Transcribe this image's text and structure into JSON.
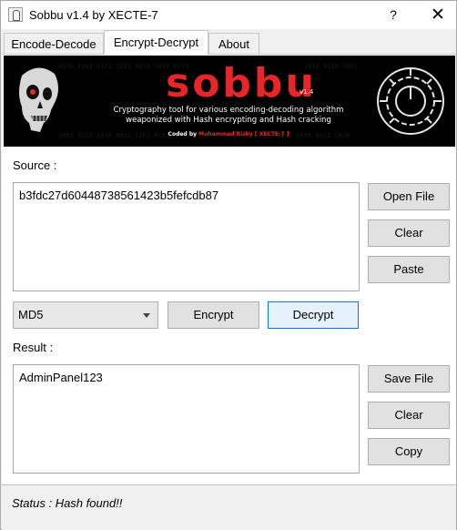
{
  "window": {
    "title": "Sobbu v1.4 by XECTE-7",
    "help": "?",
    "close": "✕"
  },
  "tabs": [
    {
      "label": "Encode-Decode"
    },
    {
      "label": "Encrypt-Decrypt"
    },
    {
      "label": "About"
    }
  ],
  "banner": {
    "logo_text": "sobbu",
    "version": "v1.4",
    "tagline1": "Cryptography tool for various encoding-decoding algorithm",
    "tagline2": "weaponized with Hash encrypting and Hash cracking",
    "coded_by": "Coded by ",
    "author": "Muhammad Rizky [ XECTE-7 ]",
    "colors": {
      "logo": "#e8262a",
      "text": "#ffffff",
      "author": "#e8262a"
    }
  },
  "source": {
    "label": "Source :",
    "value": "b3fdc27d60448738561423b5fefcdb87"
  },
  "source_buttons": {
    "open": "Open File",
    "clear": "Clear",
    "paste": "Paste"
  },
  "algorithm": {
    "selected": "MD5"
  },
  "actions": {
    "encrypt": "Encrypt",
    "decrypt": "Decrypt"
  },
  "result": {
    "label": "Result :",
    "value": "AdminPanel123"
  },
  "result_buttons": {
    "save": "Save File",
    "clear": "Clear",
    "copy": "Copy"
  },
  "status": {
    "text": "Status : Hash found!!"
  }
}
